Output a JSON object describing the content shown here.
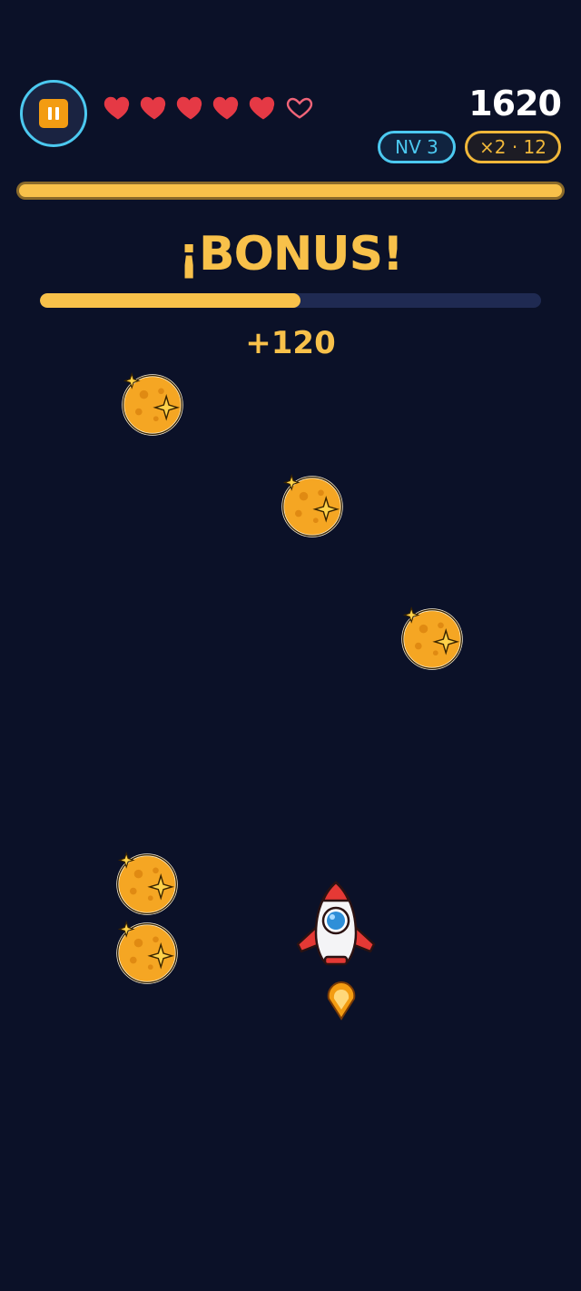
{
  "hud": {
    "score": "1620",
    "level_label": "NV 3",
    "combo_label": "×2 · 12",
    "hearts": {
      "filled": 5,
      "total": 6
    },
    "progress_fraction": 1.0
  },
  "bonus": {
    "title": "¡BONUS!",
    "points": "+120",
    "timer_fraction": 0.52
  },
  "icons": {
    "pause": "pause-icon",
    "heart_full": "heart-full-icon",
    "heart_empty": "heart-empty-icon",
    "coin": "star-coin-icon",
    "player": "rocket-icon",
    "flame": "flame-icon"
  },
  "colors": {
    "background": "#0b1128",
    "accent_cyan": "#4cc9f0",
    "accent_gold": "#f8c14a",
    "pause_orange": "#f39c12",
    "heart_red": "#e53945",
    "heart_empty_pink": "#f06478"
  }
}
